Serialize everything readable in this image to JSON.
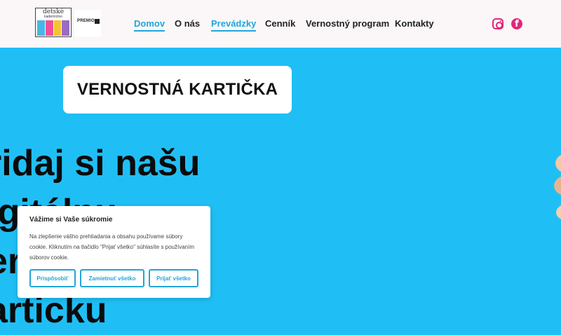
{
  "header": {
    "logo_text": "detské",
    "logo_sub": "kaderníctvo",
    "premio_text": "PREMIO",
    "nav": [
      "Domov",
      "O nás",
      "Prevádzky",
      "Cenník",
      "Vernostný program",
      "Kontakty"
    ],
    "active_items": [
      "Domov",
      "Prevádzky"
    ],
    "facebook_glyph": "f",
    "accent_color": "#21a6d8",
    "social_color": "#e4267b"
  },
  "main": {
    "card_title": "VERNOSTNÁ KARTIČKA",
    "hero_lines": [
      "ridaj si našu",
      "igitálnu",
      "er",
      "articku"
    ],
    "background_color": "#1fbff5"
  },
  "cookie": {
    "title": "Vážime si Vaše súkromie",
    "text": "Na zlepšenie vášho prehliadania a obsahu používame súbory cookie. Kliknutím na tlačidlo \"Prijať všetko\" súhlasíte s používaním súborov cookie.",
    "buttons": [
      "Prispôsobiť",
      "Zamietnuť všetko",
      "Prijať všetko"
    ]
  }
}
